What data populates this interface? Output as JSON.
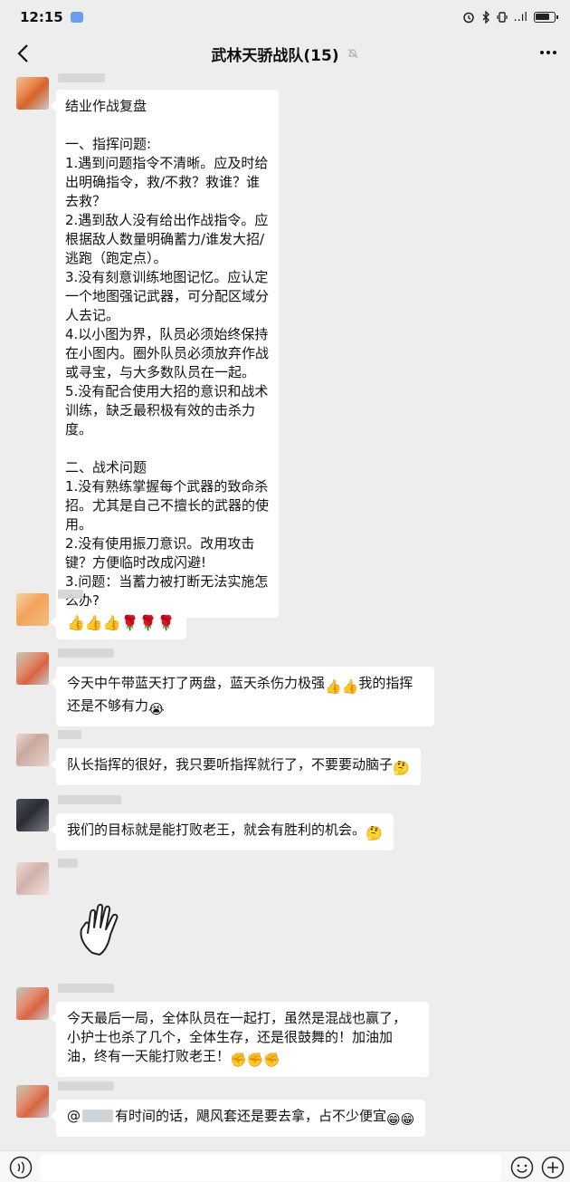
{
  "status_bar": {
    "time": "12:15",
    "signal_text": "..ıl"
  },
  "header": {
    "title": "武林天骄战队(15)"
  },
  "messages": {
    "m1": {
      "text": "结业作战复盘\n\n一、指挥问题:\n1.遇到问题指令不清晰。应及时给出明确指令，救/不救？救谁？谁去救？\n2.遇到敌人没有给出作战指令。应根据敌人数量明确蓄力/谁发大招/逃跑（跑定点）。\n3.没有刻意训练地图记忆。应认定一个地图强记武器，可分配区域分人去记。\n4.以小图为界，队员必须始终保持在小图内。圈外队员必须放弃作战或寻宝，与大多数队员在一起。\n5.没有配合使用大招的意识和战术训练，缺乏最积极有效的击杀力度。\n\n二、战术问题\n1.没有熟练掌握每个武器的致命杀招。尤其是自己不擅长的武器的使用。\n2.没有使用振刀意识。改用攻击键？方便临时改成闪避!\n3.问题：当蓄力被打断无法实施怎么办?"
    },
    "m2": {
      "emoji": "👍👍👍🌹🌹🌹"
    },
    "m3": {
      "text_a": "今天中午带蓝天打了两盘，蓝天杀伤力极强",
      "text_b": "我的指挥还是不够有力"
    },
    "m4": {
      "text": "队长指挥的很好，我只要听指挥就行了，不要要动脑子"
    },
    "m5": {
      "text": "我们的目标就是能打败老王，就会有胜利的机会。"
    },
    "m6": {
      "sticker": "waving-hand"
    },
    "m7": {
      "text": "今天最后一局，全体队员在一起打，虽然是混战也赢了，小护士也杀了几个，全体生存，还是很鼓舞的！加油加油，终有一天能打败老王！"
    },
    "m8": {
      "at": "@",
      "text": "有时间的话，飓风套还是要去拿，占不少便宜"
    }
  },
  "colors": {
    "background": "#ededed",
    "bubble": "#ffffff",
    "accent": "#6a9df2"
  }
}
